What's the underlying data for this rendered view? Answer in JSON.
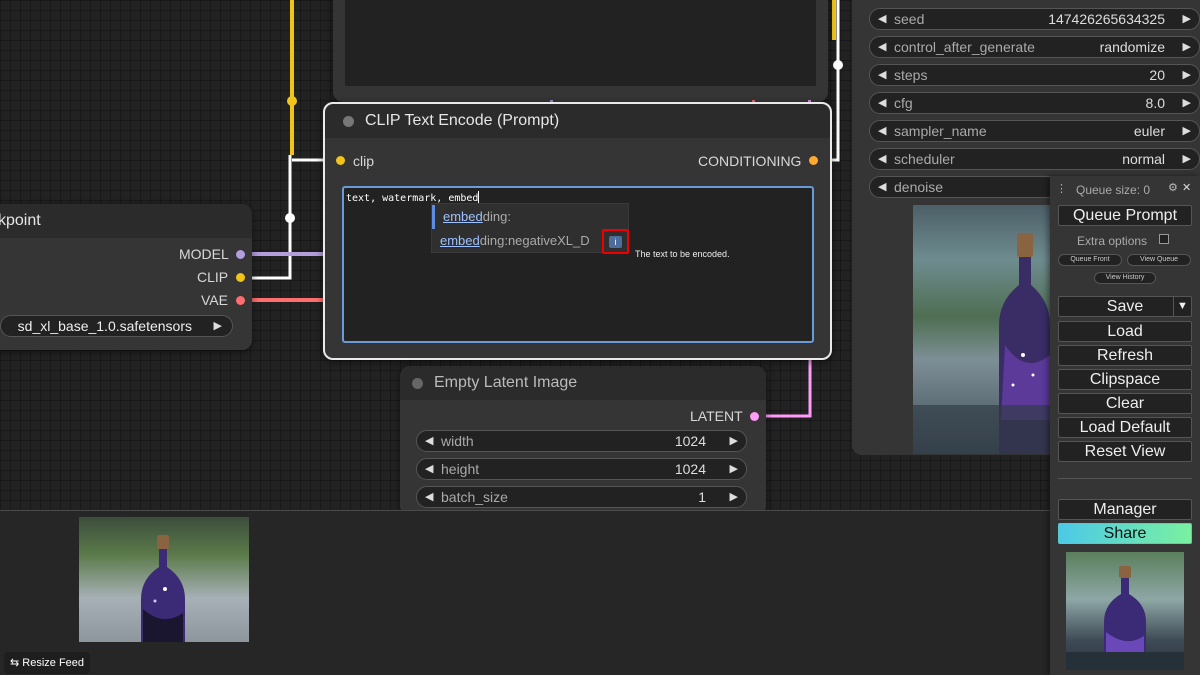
{
  "clip_node": {
    "title": "CLIP Text Encode (Prompt)",
    "input_clip": "clip",
    "output": "CONDITIONING",
    "text": "text, watermark, embed",
    "autocomplete": [
      {
        "match": "embed",
        "rest": "ding:"
      },
      {
        "match": "embed",
        "rest": "ding:negativeXL_D"
      }
    ],
    "info_icon": "info-icon",
    "tooltip": "The text to be encoded."
  },
  "checkpoint_node": {
    "title_partial": "kpoint",
    "outputs": [
      "MODEL",
      "CLIP",
      "VAE"
    ],
    "ckpt_name": "sd_xl_base_1.0.safetensors"
  },
  "latent_node": {
    "title": "Empty Latent Image",
    "output": "LATENT",
    "widgets": [
      {
        "name": "width",
        "value": "1024"
      },
      {
        "name": "height",
        "value": "1024"
      },
      {
        "name": "batch_size",
        "value": "1"
      }
    ]
  },
  "ksampler": {
    "widgets": [
      {
        "name": "seed",
        "value": "147426265634325"
      },
      {
        "name": "control_after_generate",
        "value": "randomize"
      },
      {
        "name": "steps",
        "value": "20"
      },
      {
        "name": "cfg",
        "value": "8.0"
      },
      {
        "name": "sampler_name",
        "value": "euler"
      },
      {
        "name": "scheduler",
        "value": "normal"
      },
      {
        "name": "denoise",
        "value": ""
      }
    ]
  },
  "menu": {
    "queue_size": "Queue size: 0",
    "queue_prompt": "Queue Prompt",
    "extra_options": "Extra options",
    "queue_front": "Queue Front",
    "view_queue": "View Queue",
    "view_history": "View History",
    "save": "Save",
    "load": "Load",
    "refresh": "Refresh",
    "clipspace": "Clipspace",
    "clear": "Clear",
    "load_default": "Load Default",
    "reset_view": "Reset View",
    "manager": "Manager",
    "share": "Share"
  },
  "feed": {
    "resize_label": "Resize Feed"
  },
  "colors": {
    "clip_yellow": "#f0c419",
    "model_lavender": "#b39ddb",
    "vae_red": "#ff6e6e",
    "latent_pink": "#ff9cf9",
    "conditioning_orange": "#ffa931",
    "focus_blue": "#6a9ad8",
    "highlight_red": "#e00000"
  }
}
